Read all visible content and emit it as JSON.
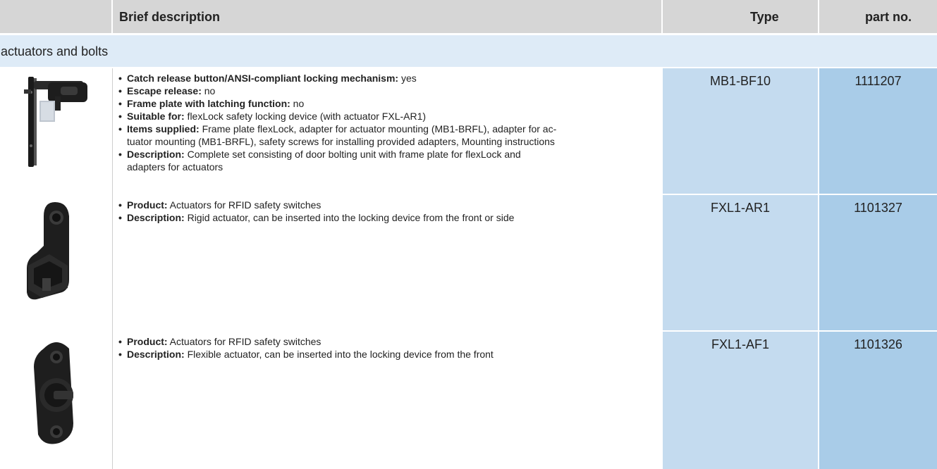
{
  "header": {
    "brief_description": "Brief description",
    "type": "Type",
    "part_no": "part no."
  },
  "group": {
    "label": "actuators and bolts"
  },
  "rows": [
    {
      "type": "MB1-BF10",
      "part_no": "1111207",
      "items": [
        {
          "key": "Catch release button/ANSI-compliant locking mechanism:",
          "value": " yes"
        },
        {
          "key": "Escape release:",
          "value": " no"
        },
        {
          "key": "Frame plate with latching function:",
          "value": " no"
        },
        {
          "key": "Suitable for:",
          "value": " flexLock safety locking device (with actuator FXL-AR1)"
        },
        {
          "key": "Items supplied:",
          "value": " Frame plate flexLock, adapter for actuator mounting (MB1-BRFL), adapter for ac-",
          "value2": "tuator mounting (MB1-BRFL), safety screws for installing provided adapters, Mounting instructions"
        },
        {
          "key": "Description:",
          "value": " Complete set consisting of door bolting unit with frame plate for flexLock and",
          "value2": "adapters for actuators"
        }
      ]
    },
    {
      "type": "FXL1-AR1",
      "part_no": "1101327",
      "items": [
        {
          "key": "Product:",
          "value": " Actuators for RFID safety switches"
        },
        {
          "key": "Description:",
          "value": " Rigid actuator, can be inserted into the locking device from the front or side"
        }
      ]
    },
    {
      "type": "FXL1-AF1",
      "part_no": "1101326",
      "items": [
        {
          "key": "Product:",
          "value": " Actuators for RFID safety switches"
        },
        {
          "key": "Description:",
          "value": " Flexible actuator, can be inserted into the locking device from the front"
        }
      ]
    }
  ]
}
